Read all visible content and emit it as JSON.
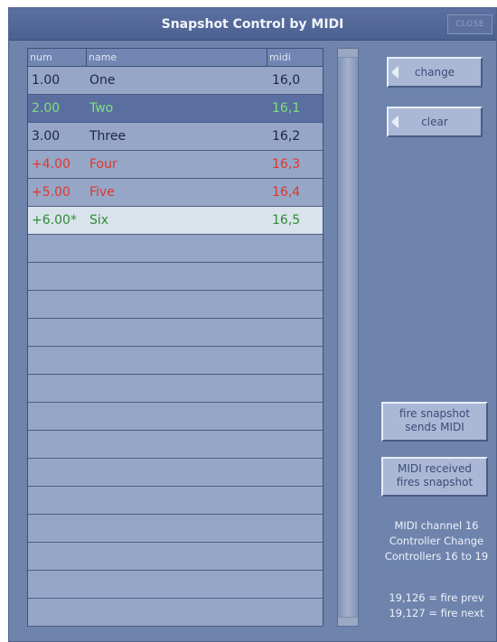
{
  "window": {
    "title": "Snapshot Control by MIDI",
    "close_label": "CLOSE"
  },
  "list": {
    "columns": [
      "num",
      "name",
      "midi"
    ],
    "rows": [
      {
        "num": "1.00",
        "name": "One",
        "midi": "16,0",
        "color": "#1e2540",
        "state": "normal"
      },
      {
        "num": "2.00",
        "name": "Two",
        "midi": "16,1",
        "color": "#7fe07f",
        "state": "selected"
      },
      {
        "num": "3.00",
        "name": "Three",
        "midi": "16,2",
        "color": "#1e2540",
        "state": "normal"
      },
      {
        "num": "+4.00",
        "name": "Four",
        "midi": "16,3",
        "color": "#e2362a",
        "state": "normal"
      },
      {
        "num": "+5.00",
        "name": "Five",
        "midi": "16,4",
        "color": "#e2362a",
        "state": "normal"
      },
      {
        "num": "+6.00*",
        "name": "Six",
        "midi": "16,5",
        "color": "#2f8a35",
        "state": "highlighted"
      }
    ],
    "empty_rows": 14
  },
  "buttons": {
    "change": "change",
    "clear": "clear",
    "fire_sends_midi": [
      "fire snapshot",
      "sends MIDI"
    ],
    "midi_received_fires": [
      "MIDI received",
      "fires snapshot"
    ]
  },
  "info": {
    "lines": [
      "MIDI channel 16",
      "Controller Change",
      "Controllers 16 to 19"
    ],
    "fire_lines": [
      "19,126 = fire prev",
      "19,127 = fire next"
    ]
  },
  "colors": {
    "window_bg": "#6e84ad",
    "title_bar": "#4c6192",
    "list_bg": "#95a6c7",
    "row_selected": "#5a6f9f",
    "row_highlighted": "#d9e3ec"
  }
}
